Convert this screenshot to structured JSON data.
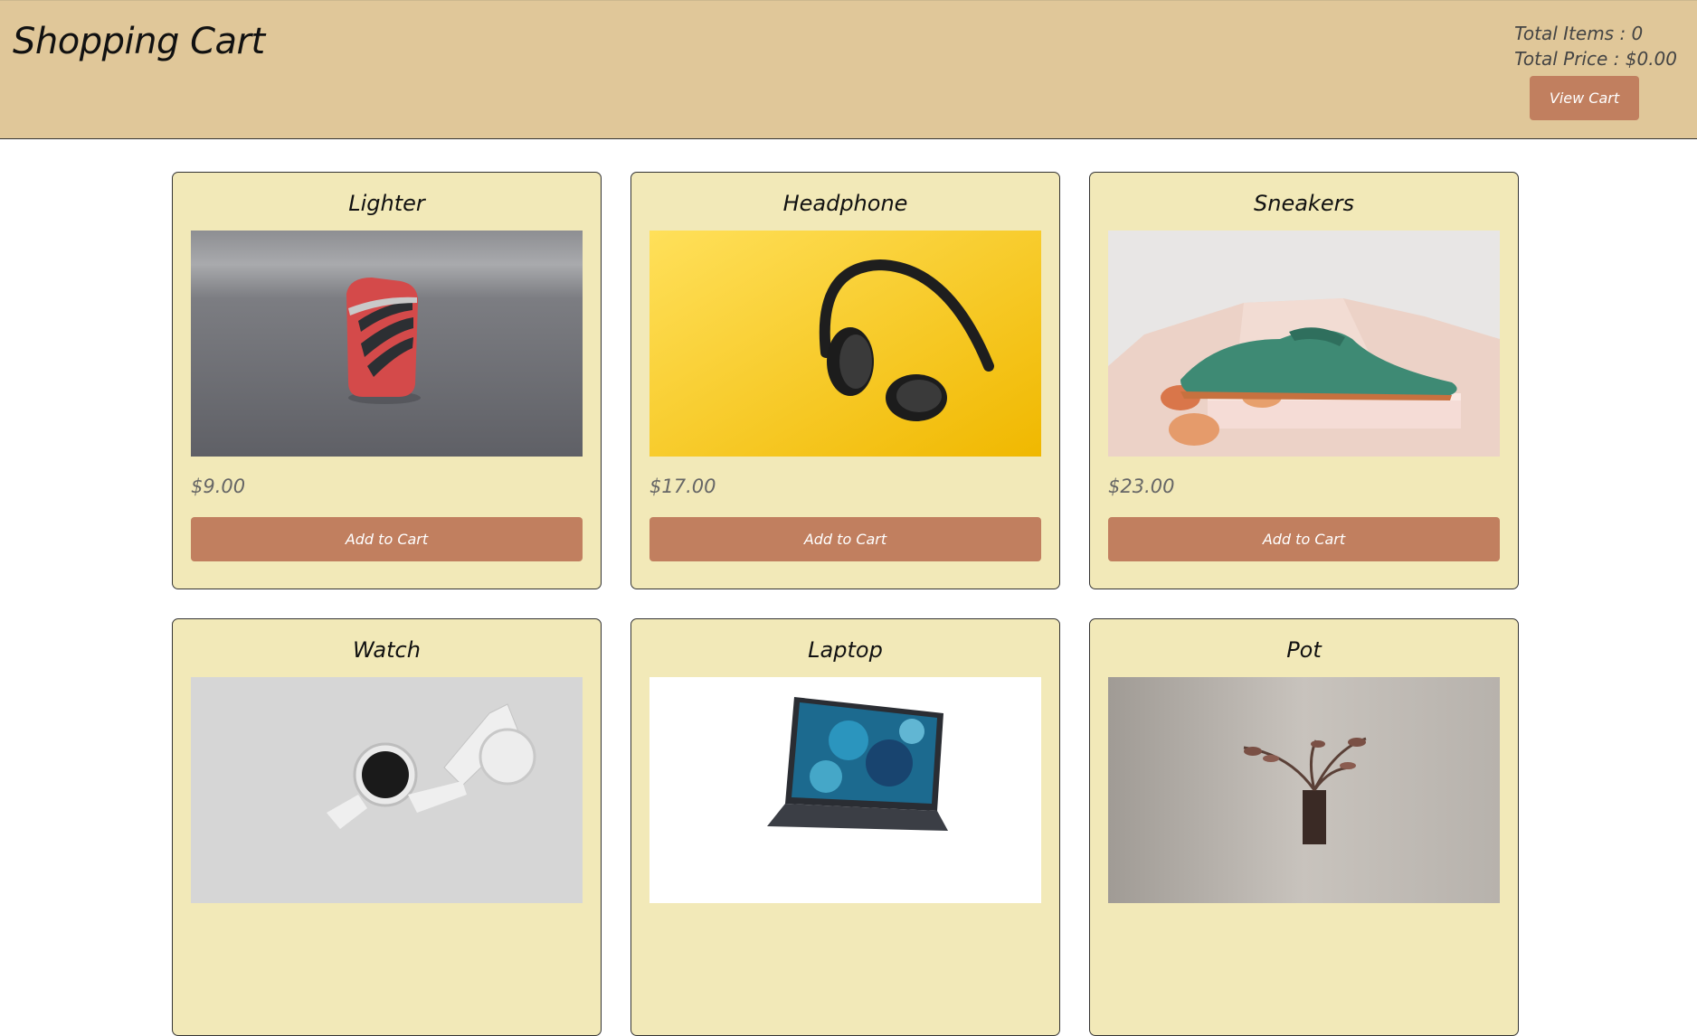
{
  "header": {
    "title": "Shopping Cart",
    "total_items": "Total Items : 0",
    "total_price": "Total Price : $0.00",
    "view_cart_label": "View Cart"
  },
  "products": [
    {
      "name": "Lighter",
      "price": "$9.00",
      "button": "Add to Cart",
      "image": "red-lighter-photo"
    },
    {
      "name": "Headphone",
      "price": "$17.00",
      "button": "Add to Cart",
      "image": "headphones-photo"
    },
    {
      "name": "Sneakers",
      "price": "$23.00",
      "button": "Add to Cart",
      "image": "green-shoe-photo"
    },
    {
      "name": "Watch",
      "image": "white-watch-photo"
    },
    {
      "name": "Laptop",
      "image": "laptop-photo"
    },
    {
      "name": "Pot",
      "image": "plant-pot-photo"
    }
  ],
  "colors": {
    "header_bg": "#e0c799",
    "card_bg": "#f2e9b8",
    "accent": "#c17f5f"
  }
}
